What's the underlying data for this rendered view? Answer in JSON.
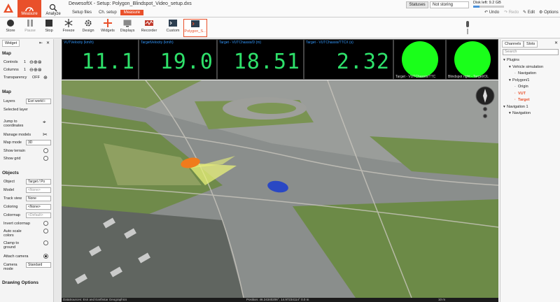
{
  "header": {
    "app_title": "DewesoftX - Setup: Polygon_Blindspot_Video_setup.dxs",
    "nav": [
      {
        "label": "Measure"
      },
      {
        "label": "Analyze"
      }
    ],
    "subtabs": [
      "Setup files",
      "Ch. setup",
      "Measure"
    ],
    "statuses_label": "Statuses",
    "storing_label": "Not storing",
    "disk_label": "Disk left: 9.2 GB",
    "disk_fraction": 0.2,
    "undo_label": "Undo",
    "redo_label": "Redo",
    "edit_label": "Edit",
    "options_label": "Options"
  },
  "toolbar": {
    "store": "Store",
    "pause": "Pause",
    "stop": "Stop",
    "freeze": "Freeze",
    "design": "Design",
    "widgets": "Widgets",
    "displays": "Displays",
    "recorder": "Recorder",
    "custom": "Custom",
    "polygon": "Polygon_S..."
  },
  "left_panel": {
    "tab": "Widget",
    "map_section": "Map",
    "controls_label": "Controls",
    "controls_value": "1",
    "columns_label": "Columns",
    "columns_value": "1",
    "transparency_label": "Transparency",
    "transparency_value": "OFF",
    "map_section2": "Map",
    "layers_label": "Layers",
    "layers_value": "Esri world i",
    "selected_layer_label": "Selected layer",
    "jump_label": "Jump to coordinates",
    "manage_models_label": "Manage models",
    "map_mode_label": "Map mode",
    "map_mode_value": "3D",
    "show_terrain_label": "Show terrain",
    "show_grid_label": "Show grid",
    "objects_section": "Objects",
    "object_label": "Object",
    "object_value": "Target / Po",
    "model_label": "Model",
    "model_value": "<None>",
    "track_view_label": "Track view",
    "track_view_value": "None",
    "coloring_label": "Coloring",
    "coloring_value": "<None>",
    "colormap_label": "Colormap",
    "colormap_value": "<Default>",
    "invert_colormap_label": "Invert colormap",
    "auto_scale_label": "Auto scale colors",
    "clamp_label": "Clamp to ground",
    "attach_camera_label": "Attach camera",
    "camera_mode_label": "Camera mode",
    "camera_mode_value": "Standard",
    "drawing_options_section": "Drawing Options"
  },
  "displays": [
    {
      "title": "VUTVelocity (km/h)",
      "value": "11.1"
    },
    {
      "title": "TargetVelocity (km/h)",
      "value": "19.0"
    },
    {
      "title": "Target - VUTChassis/D (m)",
      "value": "18.51"
    },
    {
      "title": "Target - VUTChassis/TTCX (s)",
      "value": "2.32"
    }
  ],
  "lamps": [
    {
      "label": "Target - VUTChassis/TTC",
      "color": "#1aff1a"
    },
    {
      "label": "Blindspot right - Target/OL",
      "color": "#1aff1a"
    }
  ],
  "map": {
    "datasource": "DataSources: Esri and Earthstar Geographics",
    "position": "Position: 46.24340206°, 14.97234114°  0.0 m",
    "scale": "10 m"
  },
  "right_panel": {
    "tab_channels": "Channels",
    "tab_slots": "Slots",
    "search_placeholder": "Search",
    "tree": [
      {
        "label": "Plugins",
        "indent": 0,
        "orange": false
      },
      {
        "label": "Vehicle simulation",
        "indent": 1,
        "orange": false
      },
      {
        "label": "Navigation",
        "indent": 2,
        "orange": false
      },
      {
        "label": "Polygon/1",
        "indent": 1,
        "orange": false
      },
      {
        "label": "Origin",
        "indent": 2,
        "orange": false
      },
      {
        "label": "VUT",
        "indent": 2,
        "orange": true
      },
      {
        "label": "Target",
        "indent": 2,
        "orange": true
      },
      {
        "label": "Navigation 1",
        "indent": 0,
        "orange": false
      },
      {
        "label": "Navigation",
        "indent": 1,
        "orange": false
      }
    ]
  }
}
